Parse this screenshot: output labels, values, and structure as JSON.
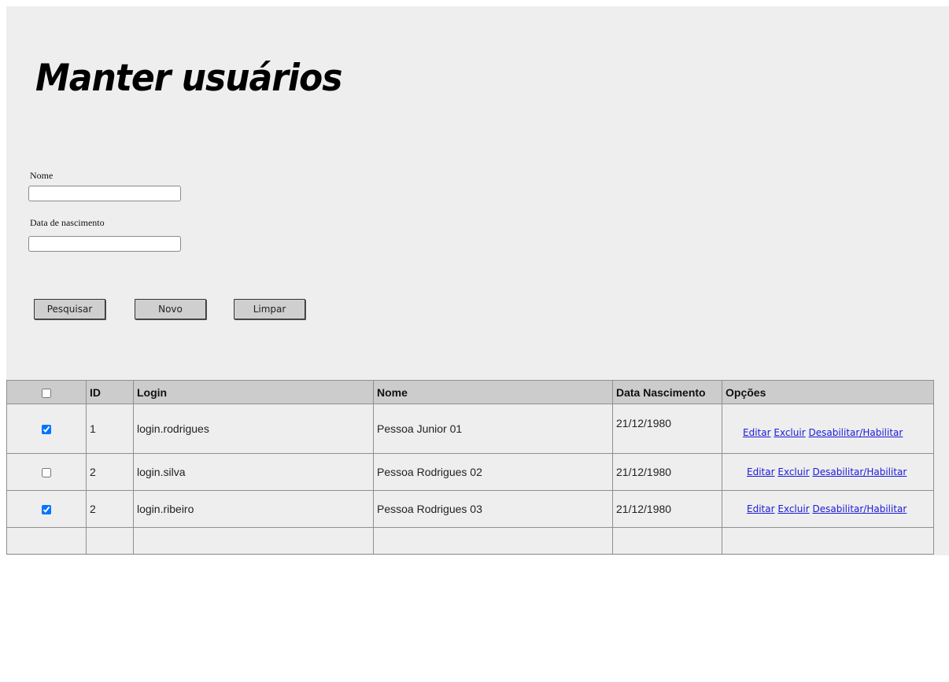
{
  "page": {
    "title": "Manter usuários"
  },
  "form": {
    "nome_label": "Nome",
    "nome_value": "",
    "data_label": "Data de nascimento",
    "data_value": ""
  },
  "buttons": {
    "pesquisar": "Pesquisar",
    "novo": "Novo",
    "limpar": "Limpar"
  },
  "table": {
    "columns": [
      "",
      "ID",
      "Login",
      "Nome",
      "Data Nascimento",
      "Opções"
    ],
    "header_checked": false,
    "rows": [
      {
        "checked": true,
        "id": "1",
        "login": "login.rodrigues",
        "nome": "Pessoa Junior 01",
        "data": "21/12/1980",
        "opt_editar": "Editar",
        "opt_excluir": "Excluir",
        "opt_toggle": "Desabilitar/Habilitar"
      },
      {
        "checked": false,
        "id": "2",
        "login": "login.silva",
        "nome": "Pessoa Rodrigues 02",
        "data": "21/12/1980",
        "opt_editar": "Editar",
        "opt_excluir": "Excluir",
        "opt_toggle": "Desabilitar/Habilitar"
      },
      {
        "checked": true,
        "id": "2",
        "login": "login.ribeiro",
        "nome": "Pessoa Rodrigues 03",
        "data": "21/12/1980",
        "opt_editar": "Editar",
        "opt_excluir": "Excluir",
        "opt_toggle": "Desabilitar/Habilitar"
      }
    ]
  }
}
